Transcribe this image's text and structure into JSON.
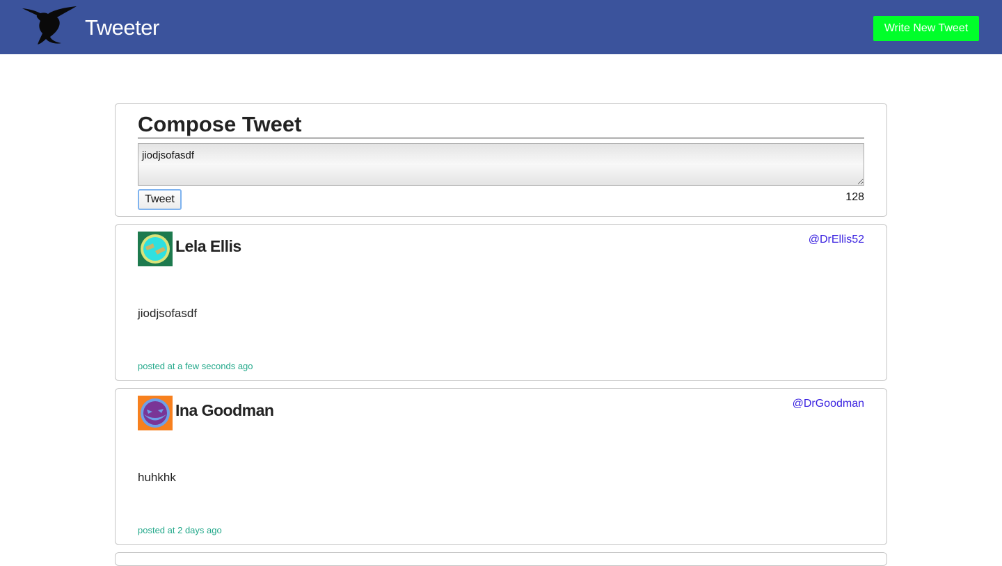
{
  "navbar": {
    "brand": "Tweeter",
    "logo_icon": "hummingbird-icon",
    "write_button_label": "Write New Tweet",
    "colors": {
      "bar": "#3b539c",
      "write_button": "#00ff2a"
    }
  },
  "compose": {
    "title": "Compose Tweet",
    "textarea_value": "jiodjsofasdf",
    "tweet_button_label": "Tweet",
    "char_counter": "128"
  },
  "tweets": [
    {
      "name": "Lela Ellis",
      "handle": "@DrEllis52",
      "body": "jiodjsofasdf",
      "time": "posted at a few seconds ago",
      "avatar_icon": "avatar-icon"
    },
    {
      "name": "Ina Goodman",
      "handle": "@DrGoodman",
      "body": "huhkhk",
      "time": "posted at 2 days ago",
      "avatar_icon": "avatar-icon"
    }
  ]
}
